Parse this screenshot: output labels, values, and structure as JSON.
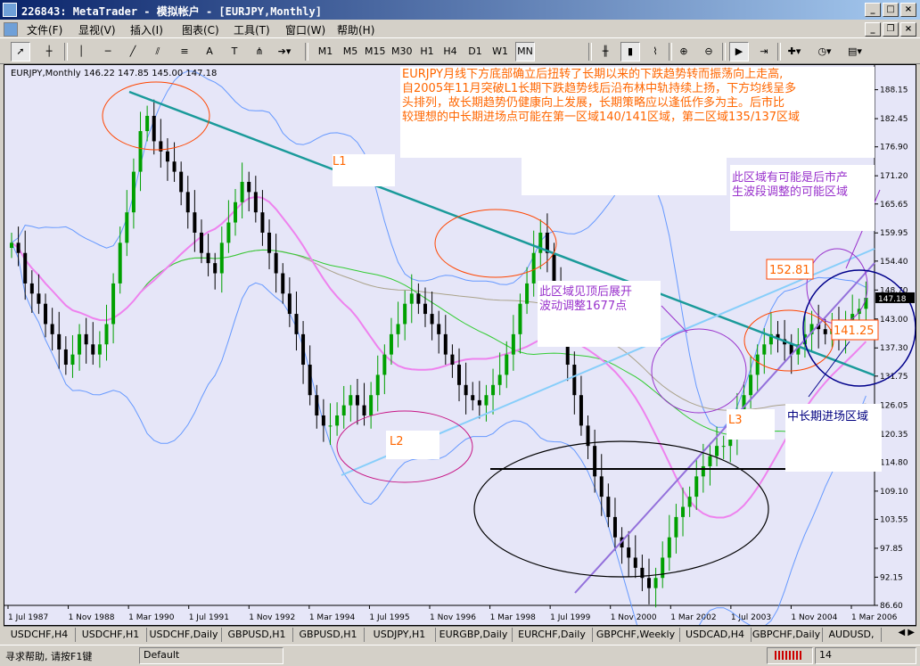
{
  "window": {
    "title": "226843: MetaTrader - 模拟帐户 - [EURJPY,Monthly]",
    "buttons": [
      "_",
      "□",
      "×"
    ],
    "mdi_buttons": [
      "_",
      "❐",
      "×"
    ]
  },
  "menu": [
    "文件(F)",
    "显视(V)",
    "插入(I)",
    "图表(C)",
    "工具(T)",
    "窗口(W)",
    "帮助(H)"
  ],
  "timeframes": [
    "M1",
    "M5",
    "M15",
    "M30",
    "H1",
    "H4",
    "D1",
    "W1",
    "MN"
  ],
  "active_timeframe": "MN",
  "chart": {
    "header": "EURJPY,Monthly  146.22 147.85 145.00 147.18",
    "annotation_main": [
      "EURJPY月线下方底部确立后扭转了长期以来的下跌趋势转而振荡向上走高,",
      "自2005年11月突破L1长期下跌趋势线后沿布林中轨持续上扬，下方均线呈多",
      "头排列，故长期趋势仍健康向上发展，长期策略应以逢低作多为主。后市比",
      "较理想的中长期进场点可能在第一区域140/141区域，第二区域135/137区域"
    ],
    "annotation_right": [
      "此区域有可能是后市产",
      "生波段调整的可能区域"
    ],
    "annotation_mid": [
      "此区域见顶后展开",
      "波动调整1677点"
    ],
    "annotation_entry": "中长期进场区域",
    "label_l1": "L1",
    "label_l2": "L2",
    "label_l3": "L3",
    "label_high": "152.81",
    "label_low": "141.25",
    "current_price": "147.18",
    "colors": {
      "background": "#e6e6f8",
      "bull": "#00a000",
      "bear": "#000000",
      "trend_l1": "#1a9a9a",
      "trend_l2": "#87cefa",
      "trend_l3": "#9370db",
      "ma_pink": "#ee82ee",
      "ma_green": "#33cc33",
      "bollinger": "#6699ff",
      "annotation": "#ff6600",
      "annotation_purple": "#9932cc"
    }
  },
  "chart_data": {
    "type": "candlestick",
    "symbol": "EURJPY",
    "timeframe": "Monthly",
    "ohlc_latest": {
      "open": 146.22,
      "high": 147.85,
      "low": 145.0,
      "close": 147.18
    },
    "y_ticks": [
      188.15,
      182.45,
      176.9,
      171.2,
      165.65,
      159.95,
      154.4,
      148.7,
      143.0,
      137.3,
      131.75,
      126.05,
      120.35,
      114.8,
      109.1,
      103.55,
      97.85,
      92.15,
      86.6
    ],
    "x_ticks": [
      "1 Jul 1987",
      "1 Nov 1988",
      "1 Mar 1990",
      "1 Jul 1991",
      "1 Nov 1992",
      "1 Mar 1994",
      "1 Jul 1995",
      "1 Nov 1996",
      "1 Mar 1998",
      "1 Jul 1999",
      "1 Nov 2000",
      "1 Mar 2002",
      "1 Jul 2003",
      "1 Nov 2004",
      "1 Mar 2006"
    ],
    "ylim": [
      86.6,
      193.0
    ],
    "closes": [
      158,
      156,
      150,
      148,
      146,
      142,
      140,
      137,
      134,
      136,
      140,
      138,
      136,
      138,
      142,
      150,
      158,
      164,
      172,
      180,
      183,
      178,
      176,
      174,
      172,
      168,
      164,
      160,
      156,
      154,
      152,
      158,
      162,
      166,
      170,
      168,
      164,
      160,
      156,
      152,
      148,
      144,
      140,
      134,
      128,
      124,
      122,
      122,
      124,
      126,
      128,
      126,
      124,
      128,
      132,
      136,
      140,
      142,
      146,
      148,
      146,
      144,
      142,
      140,
      136,
      134,
      130,
      128,
      127,
      126,
      128,
      130,
      132,
      136,
      140,
      146,
      150,
      156,
      160,
      156,
      150,
      142,
      134,
      128,
      122,
      118,
      112,
      108,
      104,
      100,
      98,
      96,
      94,
      92,
      90,
      92,
      96,
      100,
      104,
      106,
      108,
      112,
      114,
      116,
      118,
      118,
      120,
      124,
      128,
      132,
      136,
      138,
      140,
      139,
      138,
      136,
      138,
      140,
      142,
      141,
      140,
      141,
      140,
      142,
      144,
      145,
      147.18
    ]
  },
  "tabs": [
    "USDCHF,H4",
    "USDCHF,H1",
    "USDCHF,Daily",
    "GBPUSD,H1",
    "GBPUSD,H1",
    "USDJPY,H1",
    "EURGBP,Daily",
    "EURCHF,Daily",
    "GBPCHF,Weekly",
    "USDCAD,H4",
    "GBPCHF,Daily",
    "AUDUSD,"
  ],
  "status": {
    "help": "寻求帮助, 请按F1键",
    "profile": "Default",
    "kb": "14"
  }
}
